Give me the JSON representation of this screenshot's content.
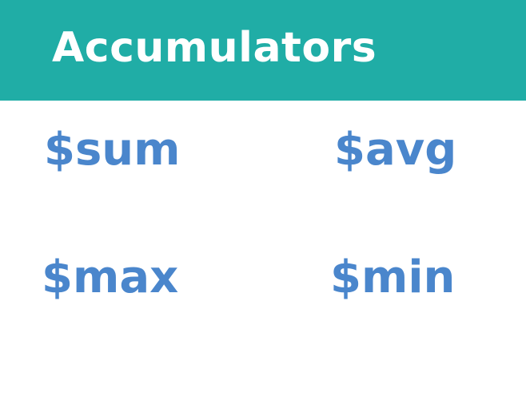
{
  "header": {
    "title": "Accumulators",
    "background": "#20ada6"
  },
  "accumulators": [
    {
      "label": "$sum"
    },
    {
      "label": "$avg"
    },
    {
      "label": "$max"
    },
    {
      "label": "$min"
    }
  ],
  "colors": {
    "title_text": "#ffffff",
    "accumulator_text": "#4a86cc",
    "page_background": "#ffffff"
  }
}
